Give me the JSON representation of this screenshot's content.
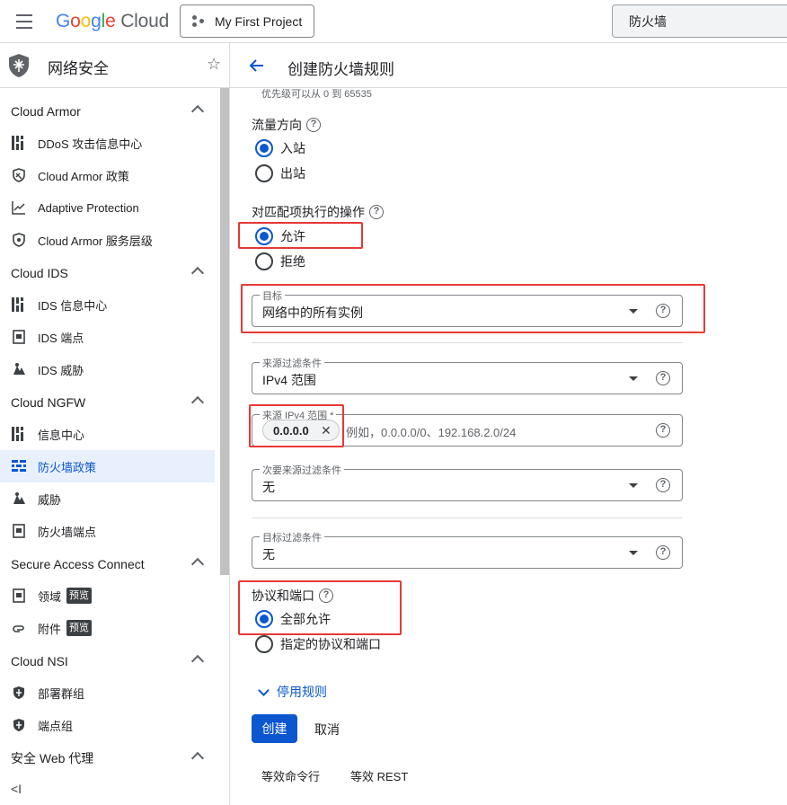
{
  "topbar": {
    "logo_letters": [
      "G",
      "o",
      "o",
      "g",
      "l",
      "e"
    ],
    "logo_cloud": "Cloud",
    "project": "My First Project",
    "search_value": "防火墙"
  },
  "sidebar": {
    "title": "网络安全",
    "sections": [
      {
        "label": "Cloud Armor",
        "items": [
          {
            "label": "DDoS 攻击信息中心",
            "icon": "dashboard-icon"
          },
          {
            "label": "Cloud Armor 政策",
            "icon": "shield-policy-icon"
          },
          {
            "label": "Adaptive Protection",
            "icon": "chart-trend-icon"
          },
          {
            "label": "Cloud Armor 服务层级",
            "icon": "shield-tier-icon"
          }
        ]
      },
      {
        "label": "Cloud IDS",
        "items": [
          {
            "label": "IDS 信息中心",
            "icon": "dashboard-icon"
          },
          {
            "label": "IDS 端点",
            "icon": "endpoint-icon"
          },
          {
            "label": "IDS 威胁",
            "icon": "threat-icon"
          }
        ]
      },
      {
        "label": "Cloud NGFW",
        "items": [
          {
            "label": "信息中心",
            "icon": "dashboard-icon"
          },
          {
            "label": "防火墙政策",
            "icon": "firewall-icon",
            "active": true
          },
          {
            "label": "威胁",
            "icon": "threat-icon"
          },
          {
            "label": "防火墙端点",
            "icon": "endpoint-icon"
          }
        ]
      },
      {
        "label": "Secure Access Connect",
        "items": [
          {
            "label": "领域",
            "icon": "endpoint-icon",
            "badge": "预览"
          },
          {
            "label": "附件",
            "icon": "attachment-icon",
            "badge": "预览"
          }
        ]
      },
      {
        "label": "Cloud NSI",
        "items": [
          {
            "label": "部署群组",
            "icon": "shield-group-icon"
          },
          {
            "label": "端点组",
            "icon": "shield-group-icon"
          }
        ]
      },
      {
        "label": "安全 Web 代理",
        "items": []
      }
    ],
    "collapse_glyph": "<I"
  },
  "main": {
    "title": "创建防火墙规则",
    "priority_hint": "优先级可以从 0 到 65535",
    "direction": {
      "label": "流量方向",
      "options": [
        "入站",
        "出站"
      ],
      "selected": 0
    },
    "action": {
      "label": "对匹配项执行的操作",
      "options": [
        "允许",
        "拒绝"
      ],
      "selected": 0
    },
    "target": {
      "label": "目标",
      "value": "网络中的所有实例"
    },
    "source_filter": {
      "label": "来源过滤条件",
      "value": "IPv4 范围"
    },
    "source_ipv4": {
      "label": "来源 IPv4 范围 *",
      "chip": "0.0.0.0",
      "chip_close": "✕",
      "placeholder": "例如，0.0.0.0/0、192.168.2.0/24"
    },
    "secondary_filter": {
      "label": "次要来源过滤条件",
      "value": "无"
    },
    "target_filter": {
      "label": "目标过滤条件",
      "value": "无"
    },
    "protocols": {
      "label": "协议和端口",
      "options": [
        "全部允许",
        "指定的协议和端口"
      ],
      "selected": 0
    },
    "disable_rules": "停用规则",
    "create": "创建",
    "cancel": "取消",
    "equiv_cmd": "等效命令行",
    "equiv_rest": "等效 REST",
    "help_glyph": "?"
  },
  "colors": {
    "accent": "#0b57d0",
    "highlight": "#e53935",
    "active_bg": "#e8f0fe"
  }
}
